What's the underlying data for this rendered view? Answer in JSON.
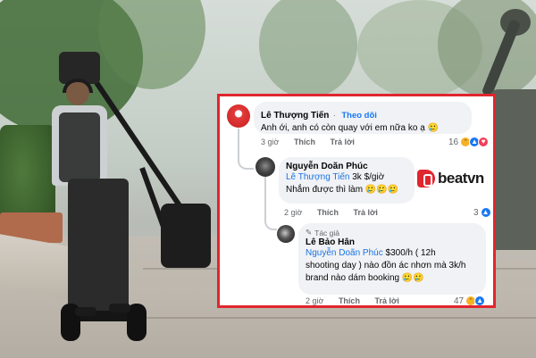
{
  "comments": [
    {
      "author": "Lê Thượng Tiến",
      "follow_label": "Theo dõi",
      "text": "Anh ới, anh có còn quay với em nữa ko ạ",
      "emoji": "🥲",
      "time": "3 giờ",
      "like_label": "Thích",
      "reply_label": "Trả lời",
      "reaction_count": "16"
    },
    {
      "author": "Nguyễn Doãn Phúc",
      "mention": "Lê Thượng Tiến",
      "text_after_mention": " 3k $/giờ",
      "text_line2": "Nhắm được thì làm",
      "emoji": "🥲🥲🥲",
      "time": "2 giờ",
      "like_label": "Thích",
      "reply_label": "Trả lời",
      "reaction_count": "3"
    },
    {
      "author_tag": "Tác giả",
      "author": "Lê Bảo Hân",
      "mention": "Nguyễn Doãn Phúc",
      "text_after_mention": " $300/h ( 12h",
      "text_line2": "shooting day ) nào đồn ác nhơn mà 3k/h",
      "text_line3": "brand nào dám booking",
      "emoji": "🥲🥲",
      "time": "2 giờ",
      "like_label": "Thích",
      "reply_label": "Trả lời",
      "reaction_count": "47"
    }
  ],
  "logo": {
    "text": "beatvn",
    "color": "#e0262e"
  },
  "colors": {
    "frame": "#e0262e",
    "bubble": "#f0f2f5",
    "link": "#1b74e4"
  }
}
